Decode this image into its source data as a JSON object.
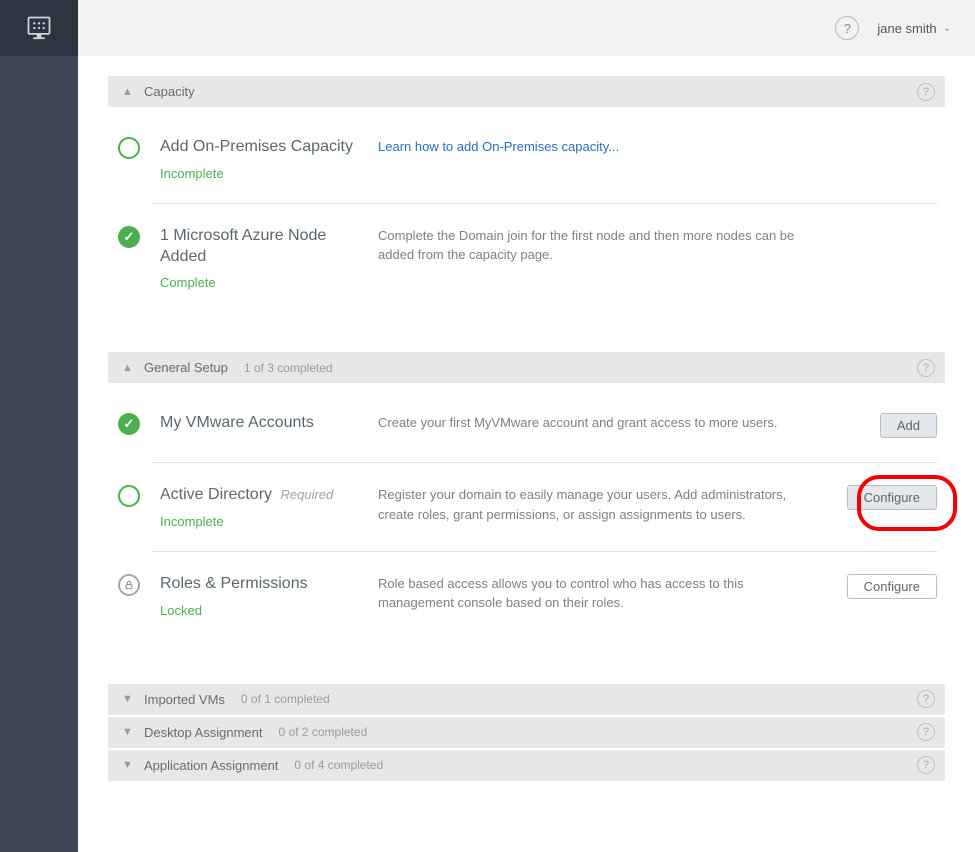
{
  "topbar": {
    "user_name": "jane smith"
  },
  "sections": {
    "capacity": {
      "title": "Capacity",
      "items": [
        {
          "title": "Add On-Premises Capacity",
          "status": "Incomplete",
          "link_text": "Learn how to add On-Premises capacity..."
        },
        {
          "title": "1 Microsoft Azure Node Added",
          "status": "Complete",
          "desc": "Complete the Domain join for the first node and then more nodes can be added from the capacity page."
        }
      ]
    },
    "general_setup": {
      "title": "General Setup",
      "subcount": "1 of 3 completed",
      "items": [
        {
          "title": "My VMware Accounts",
          "desc": "Create your first MyVMware account and grant access to more users.",
          "action": "Add"
        },
        {
          "title": "Active Directory",
          "required_label": "Required",
          "status": "Incomplete",
          "desc": "Register your domain to easily manage your users. Add administrators, create roles, grant permissions, or assign assignments to users.",
          "action": "Configure"
        },
        {
          "title": "Roles & Permissions",
          "status": "Locked",
          "desc": "Role based access allows you to control who has access to this management console based on their roles.",
          "action": "Configure"
        }
      ]
    },
    "imported_vms": {
      "title": "Imported VMs",
      "subcount": "0 of 1 completed"
    },
    "desktop_assignment": {
      "title": "Desktop Assignment",
      "subcount": "0 of 2 completed"
    },
    "application_assignment": {
      "title": "Application Assignment",
      "subcount": "0 of 4 completed"
    }
  }
}
